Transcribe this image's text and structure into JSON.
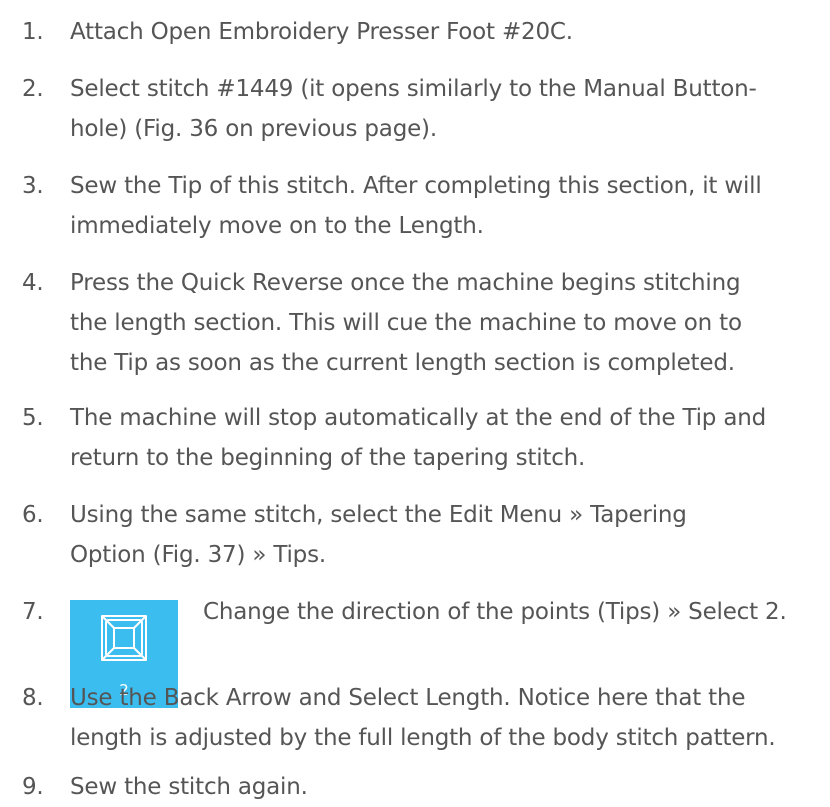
{
  "steps": [
    {
      "num": "1.",
      "lines": [
        "Attach Open Embroidery Presser Foot #20C."
      ]
    },
    {
      "num": "2.",
      "lines": [
        "Select stitch #1449 (it opens similarly to the Manual Button-",
        "hole) (Fig. 36 on previous page)."
      ]
    },
    {
      "num": "3.",
      "lines": [
        "Sew the Tip of this stitch. After completing this section, it will",
        "immediately move on to the Length."
      ]
    },
    {
      "num": "4.",
      "lines": [
        "Press the Quick Reverse once the machine begins stitching",
        "the length section. This will cue the machine to move on to",
        "the Tip as soon as the current length section is completed."
      ]
    },
    {
      "num": "5.",
      "lines": [
        "The machine will stop automatically at the end of the Tip and",
        "return to the beginning of the tapering stitch."
      ]
    },
    {
      "num": "6.",
      "lines": [
        "Using the same stitch, select the Edit Menu » Tapering",
        "Option (Fig. 37) » Tips."
      ]
    },
    {
      "num": "7.",
      "lines": [
        "Change the direction of the points (Tips) » Select 2."
      ],
      "tile": {
        "icon": "tapering-tips-icon",
        "number": "2",
        "color": "#3cbdf0"
      }
    },
    {
      "num": "8.",
      "lines": [
        "Use the Back Arrow and Select Length. Notice here that the",
        "length is adjusted by the full length of the body stitch pattern."
      ]
    },
    {
      "num": "9.",
      "lines": [
        "Sew the stitch again."
      ]
    }
  ]
}
